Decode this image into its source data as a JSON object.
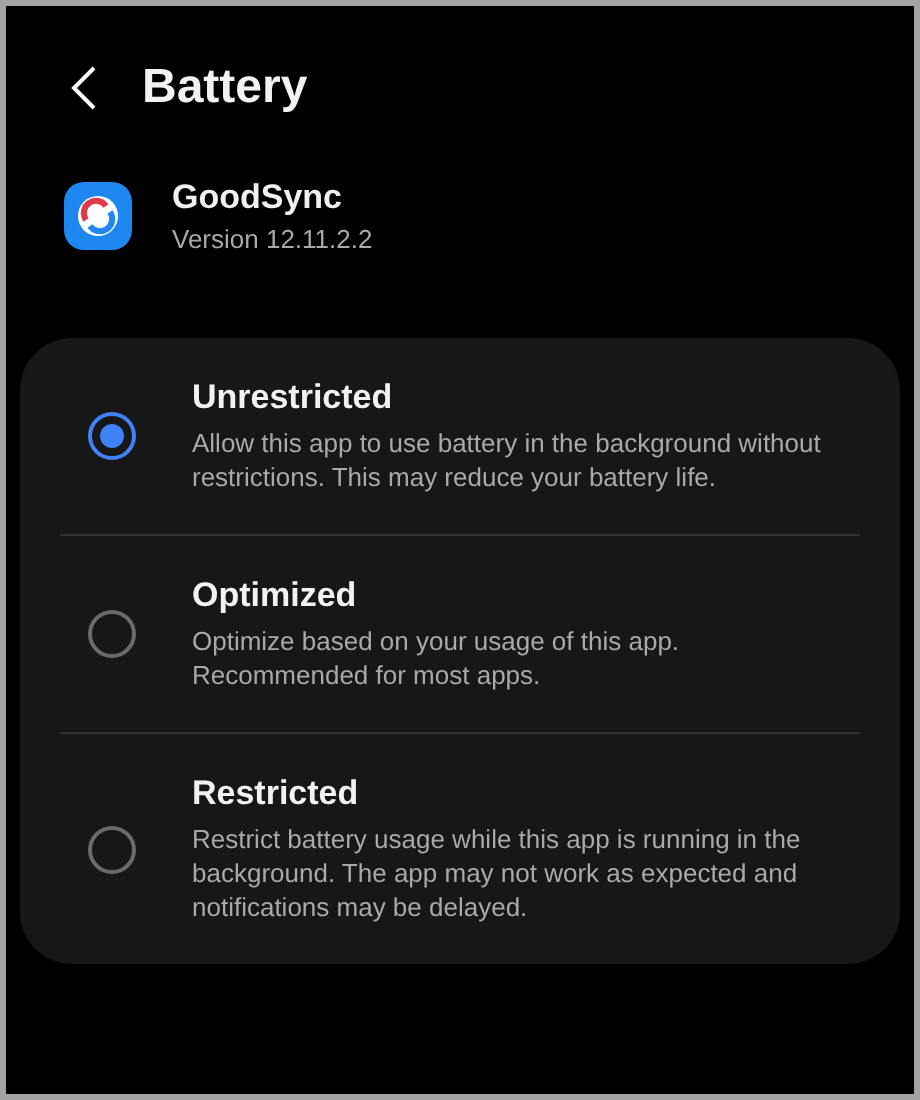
{
  "header": {
    "title": "Battery"
  },
  "app": {
    "name": "GoodSync",
    "version": "Version 12.11.2.2"
  },
  "options": [
    {
      "title": "Unrestricted",
      "description": "Allow this app to use battery in the background without restrictions. This may reduce your battery life.",
      "selected": true
    },
    {
      "title": "Optimized",
      "description": "Optimize based on your usage of this app. Recommended for most apps.",
      "selected": false
    },
    {
      "title": "Restricted",
      "description": "Restrict battery usage while this app is running in the background. The app may not work as expected and notifications may be delayed.",
      "selected": false
    }
  ]
}
